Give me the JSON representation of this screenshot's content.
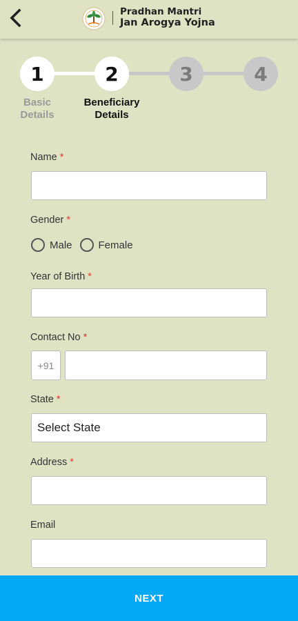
{
  "header": {
    "title_line1": "Pradhan Mantri",
    "title_line2": "Jan Arogya Yojna"
  },
  "stepper": {
    "steps": [
      {
        "number": "1",
        "label_line1": "Basic",
        "label_line2": "Details",
        "state": "done"
      },
      {
        "number": "2",
        "label_line1": "Beneficiary",
        "label_line2": "Details",
        "state": "active"
      },
      {
        "number": "3",
        "state": "pending"
      },
      {
        "number": "4",
        "state": "pending"
      }
    ]
  },
  "form": {
    "name": {
      "label": "Name",
      "required_mark": "*",
      "value": ""
    },
    "gender": {
      "label": "Gender",
      "required_mark": "*",
      "options": [
        "Male",
        "Female"
      ],
      "selected": ""
    },
    "year_of_birth": {
      "label": "Year of Birth",
      "required_mark": "*",
      "value": ""
    },
    "contact": {
      "label": "Contact No",
      "required_mark": "*",
      "prefix": "+91",
      "value": ""
    },
    "state": {
      "label": "State",
      "required_mark": "*",
      "value": "Select State"
    },
    "address": {
      "label": "Address",
      "required_mark": "*",
      "value": ""
    },
    "email": {
      "label": "Email",
      "value": ""
    }
  },
  "footer": {
    "next_label": "NEXT"
  },
  "colors": {
    "background": "#dfe3c4",
    "primary_button": "#03a9f4",
    "required": "#e53935",
    "step_pending": "#c8c8c8"
  },
  "icons": {
    "back": "arrow-back-icon",
    "logo": "pmjay-logo-icon"
  }
}
